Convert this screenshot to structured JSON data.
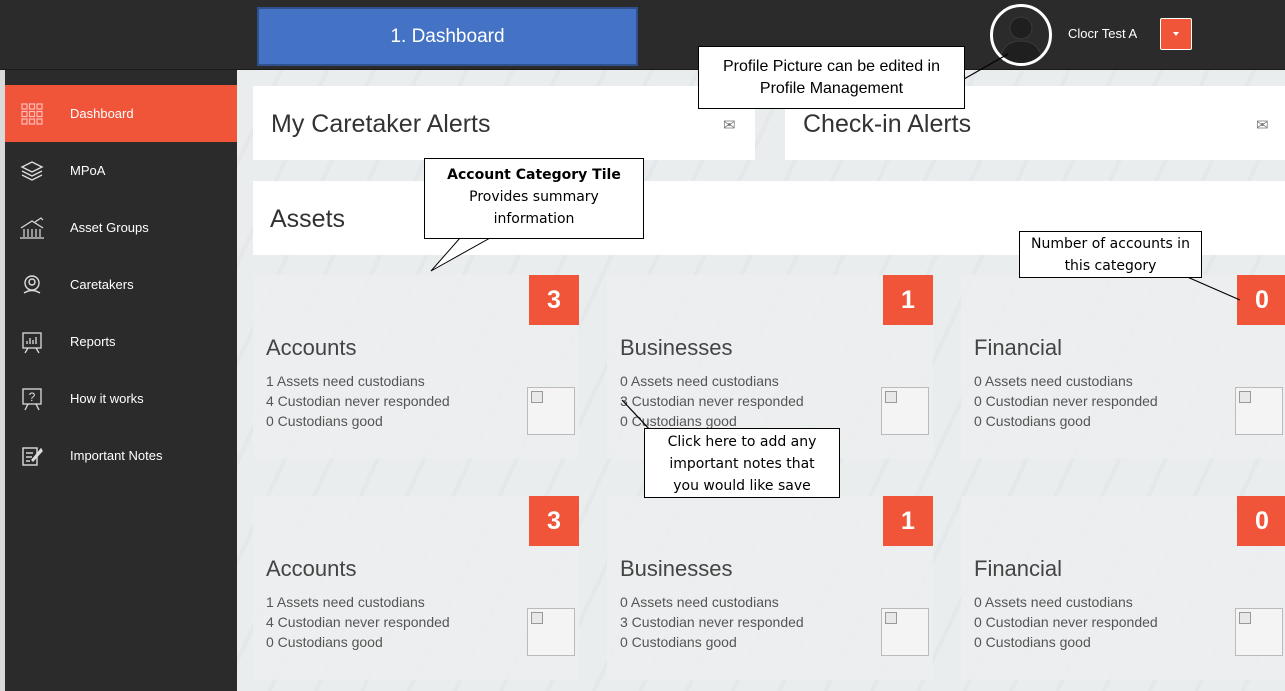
{
  "header": {
    "page_banner": "1. Dashboard",
    "user_name": "Clocr Test A"
  },
  "sidebar": {
    "items": [
      {
        "label": "Dashboard",
        "icon": "dashboard-grid-icon"
      },
      {
        "label": "MPoA",
        "icon": "layers-icon"
      },
      {
        "label": "Asset Groups",
        "icon": "asset-groups-icon"
      },
      {
        "label": "Caretakers",
        "icon": "caretakers-icon"
      },
      {
        "label": "Reports",
        "icon": "reports-icon"
      },
      {
        "label": "How it works",
        "icon": "how-it-works-icon"
      },
      {
        "label": "Important Notes",
        "icon": "important-notes-icon"
      }
    ]
  },
  "alerts": {
    "caretaker_title": "My Caretaker Alerts",
    "checkin_title": "Check-in Alerts",
    "envelope_glyph": "✉"
  },
  "assets": {
    "title": "Assets",
    "tiles": [
      {
        "title": "Accounts",
        "count": "3",
        "lines": [
          "1  Assets need custodians",
          "4  Custodian never responded",
          "0  Custodians good"
        ]
      },
      {
        "title": "Businesses",
        "count": "1",
        "lines": [
          "0  Assets need custodians",
          "3  Custodian never responded",
          "0  Custodians good"
        ]
      },
      {
        "title": "Financial",
        "count": "0",
        "lines": [
          "0  Assets need custodians",
          "0  Custodian never responded",
          "0  Custodians good"
        ]
      },
      {
        "title": "Accounts",
        "count": "3",
        "lines": [
          "1  Assets need custodians",
          "4  Custodian never responded",
          "0  Custodians good"
        ]
      },
      {
        "title": "Businesses",
        "count": "1",
        "lines": [
          "0  Assets need custodians",
          "3  Custodian never responded",
          "0  Custodians good"
        ]
      },
      {
        "title": "Financial",
        "count": "0",
        "lines": [
          "0  Assets need custodians",
          "0  Custodian never responded",
          "0  Custodians good"
        ]
      }
    ]
  },
  "callouts": {
    "profile": "Profile Picture can be edited in Profile Management",
    "tile_title": "Account Category Tile",
    "tile_body": "Provides summary information",
    "count": "Number of accounts in this category",
    "notes": "Click here to add any important notes that you would like save"
  },
  "colors": {
    "accent": "#f05539",
    "banner": "#4472c4",
    "sidebar": "#2b2b2b"
  }
}
